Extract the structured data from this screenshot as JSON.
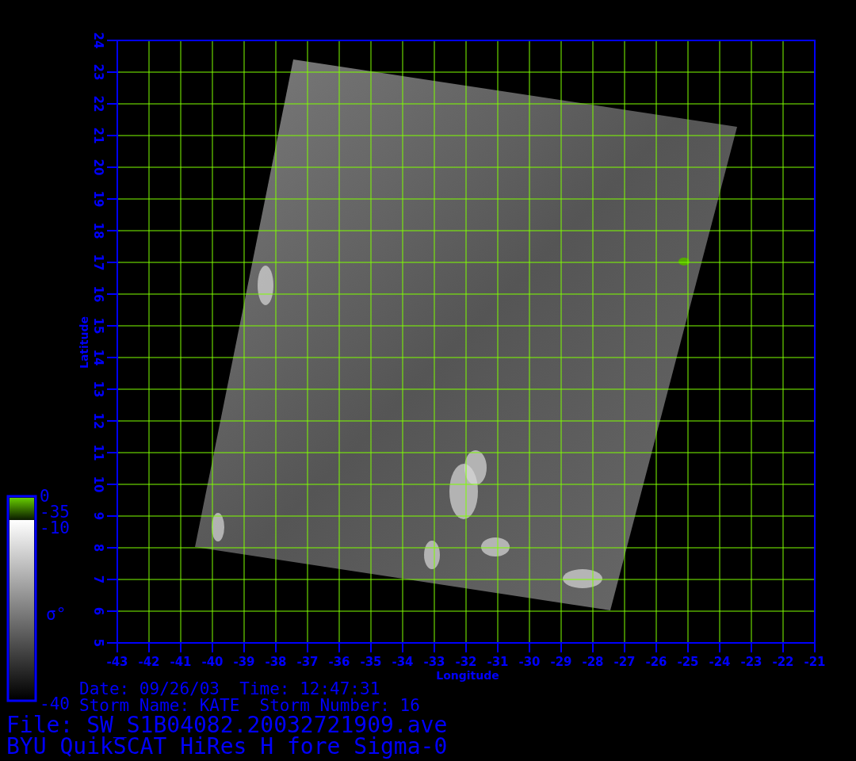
{
  "plot": {
    "xlabel": "Longitude",
    "ylabel": "Latitude",
    "xticks": [
      "-43",
      "-42",
      "-41",
      "-40",
      "-39",
      "-38",
      "-37",
      "-36",
      "-35",
      "-34",
      "-33",
      "-32",
      "-31",
      "-30",
      "-29",
      "-28",
      "-27",
      "-26",
      "-25",
      "-24",
      "-23",
      "-22",
      "-21"
    ],
    "yticks": [
      "5",
      "6",
      "7",
      "8",
      "9",
      "10",
      "11",
      "12",
      "13",
      "14",
      "15",
      "16",
      "17",
      "18",
      "19",
      "20",
      "21",
      "22",
      "23",
      "24"
    ]
  },
  "colorbar": {
    "label": "σ°",
    "ticks": [
      "0",
      "-35",
      "-10",
      "-40"
    ]
  },
  "info": {
    "date_line": "Date: 09/26/03  Time: 12:47:31",
    "storm_line": "Storm Name: KATE  Storm Number: 16"
  },
  "footer": {
    "file": "File: SW_S1B04082.20032721909.ave",
    "title": "BYU QuikSCAT HiRes H fore Sigma-0"
  }
}
